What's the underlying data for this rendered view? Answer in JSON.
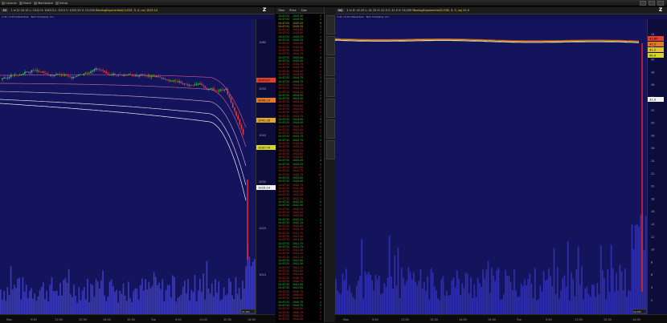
{
  "toolbar": {
    "items": [
      {
        "label": "Layouts",
        "icon": "layouts-icon"
      },
      {
        "label": "Share",
        "icon": "share-icon"
      },
      {
        "label": "Workspace",
        "icon": "workspace-icon"
      },
      {
        "label": "Setup",
        "icon": "setup-icon"
      }
    ]
  },
  "left_chart": {
    "symbol": "ES",
    "header_text": "1 m  D: 10.15  L: 1012  H: 1043.5  L: 1023  C: 1025.25  V: 12,054",
    "ma_text": "MovAvgExponential(CLOSE, 9, 0, no)  1025.14",
    "subheader": "1:41 / 0.15  Interactive · Tech Company, Inc.",
    "y_labels": [
      "1060",
      "1050",
      "1040",
      "1030",
      "1020",
      "1010"
    ],
    "price_tags": [
      {
        "value": "1047.67",
        "color": "#e0402a"
      },
      {
        "value": "1044.13",
        "color": "#e07a2a"
      },
      {
        "value": "1041.18",
        "color": "#e0a82a"
      },
      {
        "value": "1037.74",
        "color": "#d4d42a"
      },
      {
        "value": "1029.14",
        "color": "#f0f0f0"
      }
    ],
    "x_labels": [
      "Mon",
      "9:30",
      "11:00",
      "12:30",
      "14:00",
      "15:30",
      "Tue",
      "9:30",
      "11:00",
      "12:30",
      "14:00"
    ],
    "corner_label": "1s 10s"
  },
  "time_sales": {
    "headers": [
      "Time",
      "Price",
      "Size"
    ],
    "rows": [
      {
        "t": "10:47:52",
        "p": "1045.50",
        "s": "2",
        "c": "#3ad43a"
      },
      {
        "t": "10:47:52",
        "p": "1045.50",
        "s": "1",
        "c": "#3ad43a"
      },
      {
        "t": "10:47:52",
        "p": "1045.25",
        "s": "5",
        "c": "#e0c23a"
      },
      {
        "t": "10:47:52",
        "p": "1045.25",
        "s": "1",
        "c": "#e0c23a"
      },
      {
        "t": "10:47:52",
        "p": "1045.00",
        "s": "3",
        "c": "#e03a3a"
      },
      {
        "t": "10:47:52",
        "p": "1045.00",
        "s": "2",
        "c": "#e03a3a"
      },
      {
        "t": "10:47:52",
        "p": "1045.25",
        "s": "1",
        "c": "#3ad43a"
      },
      {
        "t": "10:47:52",
        "p": "1045.25",
        "s": "4",
        "c": "#3ad43a"
      },
      {
        "t": "10:47:52",
        "p": "1045.00",
        "s": "1",
        "c": "#e03a3a"
      },
      {
        "t": "10:47:52",
        "p": "1045.00",
        "s": "6",
        "c": "#e03a3a"
      },
      {
        "t": "10:47:52",
        "p": "1044.75",
        "s": "2",
        "c": "#e03a3a"
      },
      {
        "t": "10:47:52",
        "p": "1044.75",
        "s": "1",
        "c": "#e03a3a"
      },
      {
        "t": "10:47:52",
        "p": "1045.00",
        "s": "3",
        "c": "#3ad43a"
      },
      {
        "t": "10:47:52",
        "p": "1045.00",
        "s": "1",
        "c": "#3ad43a"
      },
      {
        "t": "10:47:52",
        "p": "1044.75",
        "s": "2",
        "c": "#e03a3a"
      },
      {
        "t": "10:47:52",
        "p": "1044.75",
        "s": "9",
        "c": "#e03a3a"
      },
      {
        "t": "10:47:52",
        "p": "1044.50",
        "s": "1",
        "c": "#e03a3a"
      },
      {
        "t": "10:47:52",
        "p": "1044.50",
        "s": "2",
        "c": "#e03a3a"
      },
      {
        "t": "10:47:52",
        "p": "1044.75",
        "s": "1",
        "c": "#3ad43a"
      },
      {
        "t": "10:47:52",
        "p": "1044.75",
        "s": "3",
        "c": "#3ad43a"
      },
      {
        "t": "10:47:52",
        "p": "1044.50",
        "s": "1",
        "c": "#e03a3a"
      },
      {
        "t": "10:47:52",
        "p": "1044.25",
        "s": "2",
        "c": "#e03a3a"
      },
      {
        "t": "10:47:52",
        "p": "1044.25",
        "s": "4",
        "c": "#e03a3a"
      },
      {
        "t": "10:47:52",
        "p": "1044.50",
        "s": "1",
        "c": "#3ad43a"
      },
      {
        "t": "10:47:52",
        "p": "1044.50",
        "s": "2",
        "c": "#3ad43a"
      },
      {
        "t": "10:47:52",
        "p": "1044.25",
        "s": "1",
        "c": "#e03a3a"
      },
      {
        "t": "10:47:52",
        "p": "1044.00",
        "s": "5",
        "c": "#e03a3a"
      },
      {
        "t": "10:47:52",
        "p": "1044.00",
        "s": "1",
        "c": "#e03a3a"
      },
      {
        "t": "10:47:52",
        "p": "1043.75",
        "s": "2",
        "c": "#e03a3a"
      },
      {
        "t": "10:47:52",
        "p": "1043.75",
        "s": "1",
        "c": "#e03a3a"
      },
      {
        "t": "10:47:52",
        "p": "1044.00",
        "s": "3",
        "c": "#3ad43a"
      },
      {
        "t": "10:47:52",
        "p": "1044.00",
        "s": "1",
        "c": "#3ad43a"
      },
      {
        "t": "10:47:52",
        "p": "1043.75",
        "s": "2",
        "c": "#e03a3a"
      },
      {
        "t": "10:47:52",
        "p": "1043.50",
        "s": "1",
        "c": "#e03a3a"
      },
      {
        "t": "10:47:52",
        "p": "1043.50",
        "s": "7",
        "c": "#e03a3a"
      },
      {
        "t": "10:47:52",
        "p": "1043.75",
        "s": "1",
        "c": "#3ad43a"
      },
      {
        "t": "10:47:52",
        "p": "1043.75",
        "s": "2",
        "c": "#3ad43a"
      },
      {
        "t": "10:47:52",
        "p": "1043.50",
        "s": "1",
        "c": "#e03a3a"
      },
      {
        "t": "10:47:52",
        "p": "1043.25",
        "s": "3",
        "c": "#e03a3a"
      },
      {
        "t": "10:47:52",
        "p": "1043.25",
        "s": "1",
        "c": "#e03a3a"
      },
      {
        "t": "10:47:52",
        "p": "1043.00",
        "s": "2",
        "c": "#e03a3a"
      },
      {
        "t": "10:47:52",
        "p": "1043.00",
        "s": "1",
        "c": "#e03a3a"
      },
      {
        "t": "10:47:52",
        "p": "1043.25",
        "s": "4",
        "c": "#3ad43a"
      },
      {
        "t": "10:47:52",
        "p": "1043.25",
        "s": "1",
        "c": "#3ad43a"
      },
      {
        "t": "10:47:52",
        "p": "1043.00",
        "s": "2",
        "c": "#e03a3a"
      },
      {
        "t": "10:47:52",
        "p": "1042.75",
        "s": "1",
        "c": "#e03a3a"
      },
      {
        "t": "10:47:52",
        "p": "1042.75",
        "s": "12",
        "c": "#e03a3a"
      },
      {
        "t": "10:47:52",
        "p": "1043.00",
        "s": "1",
        "c": "#3ad43a"
      },
      {
        "t": "10:47:52",
        "p": "1043.00",
        "s": "2",
        "c": "#3ad43a"
      },
      {
        "t": "10:47:52",
        "p": "1042.75",
        "s": "1",
        "c": "#e03a3a"
      },
      {
        "t": "10:47:52",
        "p": "1042.50",
        "s": "3",
        "c": "#e03a3a"
      },
      {
        "t": "10:47:52",
        "p": "1042.50",
        "s": "1",
        "c": "#e03a3a"
      },
      {
        "t": "10:47:52",
        "p": "1042.25",
        "s": "2",
        "c": "#e03a3a"
      },
      {
        "t": "10:47:52",
        "p": "1042.25",
        "s": "1",
        "c": "#e03a3a"
      },
      {
        "t": "10:47:52",
        "p": "1042.50",
        "s": "5",
        "c": "#3ad43a"
      },
      {
        "t": "10:47:52",
        "p": "1042.50",
        "s": "1",
        "c": "#3ad43a"
      },
      {
        "t": "10:47:52",
        "p": "1042.25",
        "s": "2",
        "c": "#e03a3a"
      },
      {
        "t": "10:47:52",
        "p": "1042.00",
        "s": "1",
        "c": "#e03a3a"
      },
      {
        "t": "10:47:52",
        "p": "1042.00",
        "s": "3",
        "c": "#e03a3a"
      },
      {
        "t": "10:47:52",
        "p": "1042.25",
        "s": "1",
        "c": "#3ad43a"
      },
      {
        "t": "10:47:52",
        "p": "1042.25",
        "s": "2",
        "c": "#3ad43a"
      },
      {
        "t": "10:47:52",
        "p": "1042.00",
        "s": "1",
        "c": "#e03a3a"
      },
      {
        "t": "10:47:52",
        "p": "1041.75",
        "s": "4",
        "c": "#e03a3a"
      },
      {
        "t": "10:47:52",
        "p": "1041.75",
        "s": "1",
        "c": "#e03a3a"
      },
      {
        "t": "10:47:52",
        "p": "1041.50",
        "s": "2",
        "c": "#e03a3a"
      },
      {
        "t": "10:47:52",
        "p": "1041.50",
        "s": "1",
        "c": "#e03a3a"
      },
      {
        "t": "10:47:52",
        "p": "1041.75",
        "s": "3",
        "c": "#3ad43a"
      },
      {
        "t": "10:47:52",
        "p": "1041.75",
        "s": "1",
        "c": "#3ad43a"
      },
      {
        "t": "10:47:52",
        "p": "1041.50",
        "s": "2",
        "c": "#e03a3a"
      },
      {
        "t": "10:47:52",
        "p": "1041.25",
        "s": "1",
        "c": "#e03a3a"
      },
      {
        "t": "10:47:52",
        "p": "1041.25",
        "s": "6",
        "c": "#e03a3a"
      },
      {
        "t": "10:47:52",
        "p": "1041.50",
        "s": "1",
        "c": "#3ad43a"
      },
      {
        "t": "10:47:52",
        "p": "1041.50",
        "s": "2",
        "c": "#3ad43a"
      },
      {
        "t": "10:47:52",
        "p": "1041.25",
        "s": "1",
        "c": "#e03a3a"
      },
      {
        "t": "10:47:52",
        "p": "1041.00",
        "s": "3",
        "c": "#e03a3a"
      },
      {
        "t": "10:47:52",
        "p": "1041.00",
        "s": "1",
        "c": "#e03a3a"
      },
      {
        "t": "10:47:52",
        "p": "1040.75",
        "s": "2",
        "c": "#e03a3a"
      },
      {
        "t": "10:47:52",
        "p": "1040.75",
        "s": "1",
        "c": "#e03a3a"
      },
      {
        "t": "10:47:52",
        "p": "1041.00",
        "s": "4",
        "c": "#3ad43a"
      },
      {
        "t": "10:47:52",
        "p": "1041.00",
        "s": "1",
        "c": "#3ad43a"
      },
      {
        "t": "10:47:52",
        "p": "1040.75",
        "s": "2",
        "c": "#e03a3a"
      },
      {
        "t": "10:47:52",
        "p": "1040.50",
        "s": "1",
        "c": "#e03a3a"
      },
      {
        "t": "10:47:52",
        "p": "1040.50",
        "s": "8",
        "c": "#e03a3a"
      },
      {
        "t": "10:47:52",
        "p": "1040.75",
        "s": "1",
        "c": "#3ad43a"
      },
      {
        "t": "10:47:52",
        "p": "1040.75",
        "s": "2",
        "c": "#3ad43a"
      },
      {
        "t": "10:47:52",
        "p": "1040.50",
        "s": "1",
        "c": "#e03a3a"
      },
      {
        "t": "10:47:52",
        "p": "1040.25",
        "s": "3",
        "c": "#e03a3a"
      },
      {
        "t": "10:47:52",
        "p": "1040.25",
        "s": "1",
        "c": "#e03a3a"
      },
      {
        "t": "10:47:52",
        "p": "1040.00",
        "s": "2",
        "c": "#e03a3a"
      }
    ]
  },
  "right_chart": {
    "symbol": "NQ",
    "header_text": "1 m  D: 41.25  L: 41.25  H: 41.5  C: 41.0  V: 28,330",
    "ma_text": "MovAvgExponential(CLOSE, 9, 0, no)  41.0",
    "subheader": "1:41 / 0.15  Interactive · Tech Company, Inc.",
    "y_labels": [
      "44",
      "42",
      "40",
      "38",
      "36",
      "34",
      "32",
      "30",
      "28",
      "26",
      "24",
      "22",
      "20",
      "18",
      "16",
      "14",
      "12",
      "10",
      "8",
      "6",
      "4",
      "2"
    ],
    "price_tags": [
      {
        "value": "41.84",
        "color": "#e0402a"
      },
      {
        "value": "41.5",
        "color": "#e07a2a"
      },
      {
        "value": "41.2",
        "color": "#e0c22a"
      },
      {
        "value": "40.9",
        "color": "#d4d42a"
      },
      {
        "value": "31.0",
        "color": "#f0f0f0"
      }
    ],
    "x_labels": [
      "Mon",
      "9:30",
      "11:00",
      "12:30",
      "14:00",
      "15:30",
      "Tue",
      "9:30",
      "11:00",
      "12:30",
      "14:00"
    ],
    "corner_label": "1s 10s"
  }
}
